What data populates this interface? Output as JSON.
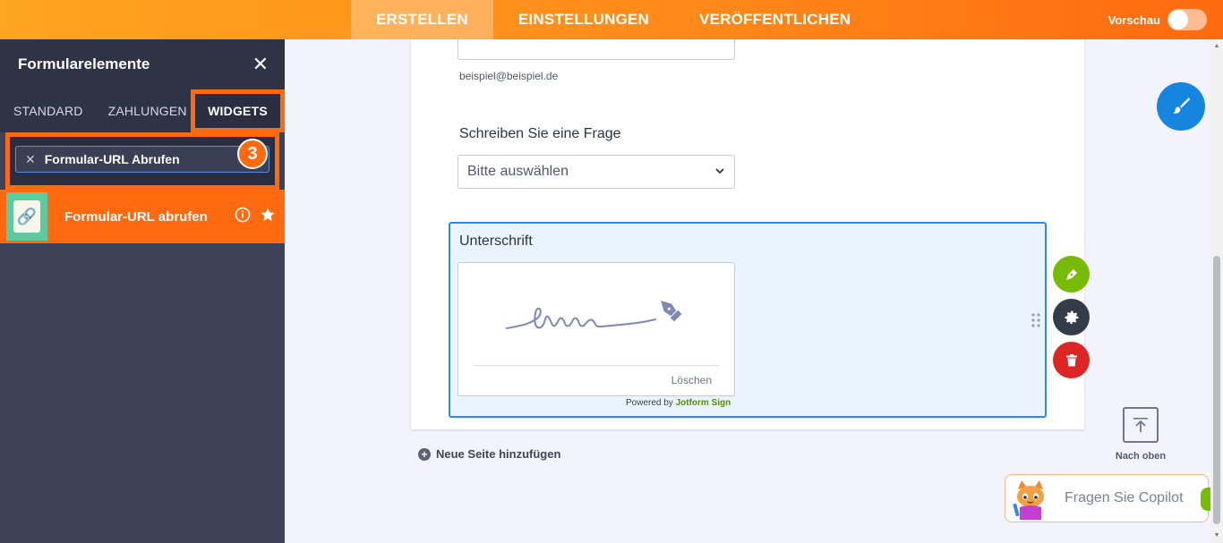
{
  "topbar": {
    "tabs": [
      {
        "label": "ERSTELLEN",
        "active": true
      },
      {
        "label": "EINSTELLUNGEN",
        "active": false
      },
      {
        "label": "VERÖFFENTLICHEN",
        "active": false
      }
    ],
    "preview_label": "Vorschau",
    "preview_on": false
  },
  "sidebar": {
    "title": "Formularelemente",
    "tabs": {
      "standard": "STANDARD",
      "payments": "ZAHLUNGEN",
      "widgets": "WIDGETS"
    },
    "search_value": "Formular-URL Abrufen",
    "step_badge": "3",
    "result_label": "Formular-URL abrufen"
  },
  "form": {
    "email_hint": "beispiel@beispiel.de",
    "question_label": "Schreiben Sie eine Frage",
    "select_value": "Bitte auswählen",
    "signature": {
      "label": "Unterschrift",
      "clear_label": "Löschen",
      "powered_prefix": "Powered by",
      "powered_brand": "Jotform Sign"
    },
    "add_page_label": "Neue Seite hinzufügen"
  },
  "back_to_top_label": "Nach oben",
  "copilot_label": "Fragen Sie Copilot",
  "colors": {
    "accent_orange": "#ff6a10",
    "brand_blue": "#1685e0",
    "green": "#78bb07",
    "red": "#dc2626"
  },
  "icons": {
    "close": "close-icon",
    "info": "info-icon",
    "star": "star-icon",
    "chevron": "chevron-down-icon",
    "pen": "pen-icon",
    "gear": "gear-icon",
    "trash": "trash-icon",
    "paint": "paint-brush-icon",
    "arrow_up": "arrow-up-icon"
  }
}
